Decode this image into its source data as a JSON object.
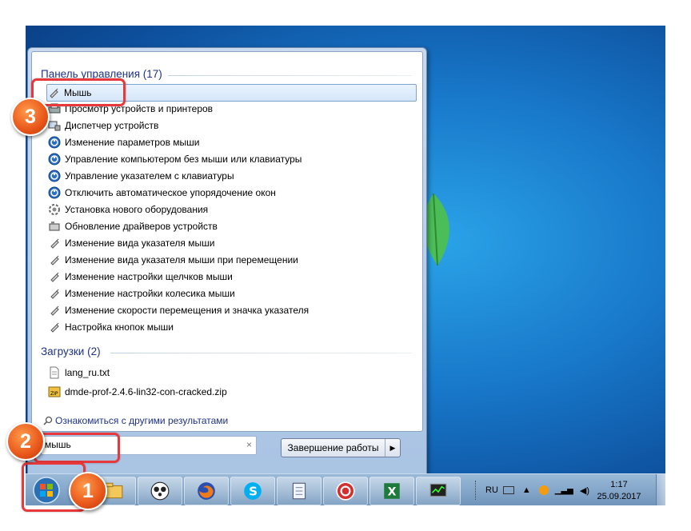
{
  "start_menu": {
    "control_panel_header": "Панель управления (17)",
    "control_panel_items": [
      {
        "label": "Мышь",
        "icon": "mouse-icon",
        "selected": true
      },
      {
        "label": "Просмотр устройств и принтеров",
        "icon": "devices-printers-icon"
      },
      {
        "label": "Диспетчер устройств",
        "icon": "device-manager-icon"
      },
      {
        "label": "Изменение параметров мыши",
        "icon": "ease-of-access-icon"
      },
      {
        "label": "Управление компьютером без мыши или клавиатуры",
        "icon": "ease-of-access-icon"
      },
      {
        "label": "Управление указателем с клавиатуры",
        "icon": "ease-of-access-icon"
      },
      {
        "label": "Отключить автоматическое упорядочение окон",
        "icon": "ease-of-access-icon"
      },
      {
        "label": "Установка нового оборудования",
        "icon": "hardware-install-icon"
      },
      {
        "label": "Обновление драйверов устройств",
        "icon": "driver-update-icon"
      },
      {
        "label": "Изменение вида указателя мыши",
        "icon": "mouse-icon"
      },
      {
        "label": "Изменение вида указателя мыши при перемещении",
        "icon": "mouse-icon"
      },
      {
        "label": "Изменение настройки щелчков мыши",
        "icon": "mouse-icon"
      },
      {
        "label": "Изменение настройки колесика мыши",
        "icon": "mouse-icon"
      },
      {
        "label": "Изменение скорости перемещения и значка указателя",
        "icon": "mouse-icon"
      },
      {
        "label": "Настройка кнопок мыши",
        "icon": "mouse-icon"
      }
    ],
    "downloads_header": "Загрузки (2)",
    "downloads_items": [
      {
        "label": "lang_ru.txt",
        "icon": "text-file-icon"
      },
      {
        "label": "dmde-prof-2.4.6-lin32-con-cracked.zip",
        "icon": "zip-file-icon"
      }
    ],
    "see_more": "Ознакомиться с другими результатами",
    "search_value": "мышь",
    "clear_symbol": "×",
    "shutdown_label": "Завершение работы",
    "shutdown_arrow": "▶"
  },
  "taskbar": {
    "buttons": [
      "explorer-icon",
      "panda-antivirus-icon",
      "firefox-icon",
      "skype-icon",
      "notepad-icon",
      "antivirus-icon",
      "excel-icon",
      "task-manager-icon"
    ],
    "tray_lang": "RU",
    "clock_time": "1:17",
    "clock_date": "25.09.2017"
  },
  "callouts": {
    "one": "1",
    "two": "2",
    "three": "3"
  },
  "colors": {
    "highlight": "#e8383b",
    "badge": "#e8561a",
    "link": "#1e3287"
  }
}
